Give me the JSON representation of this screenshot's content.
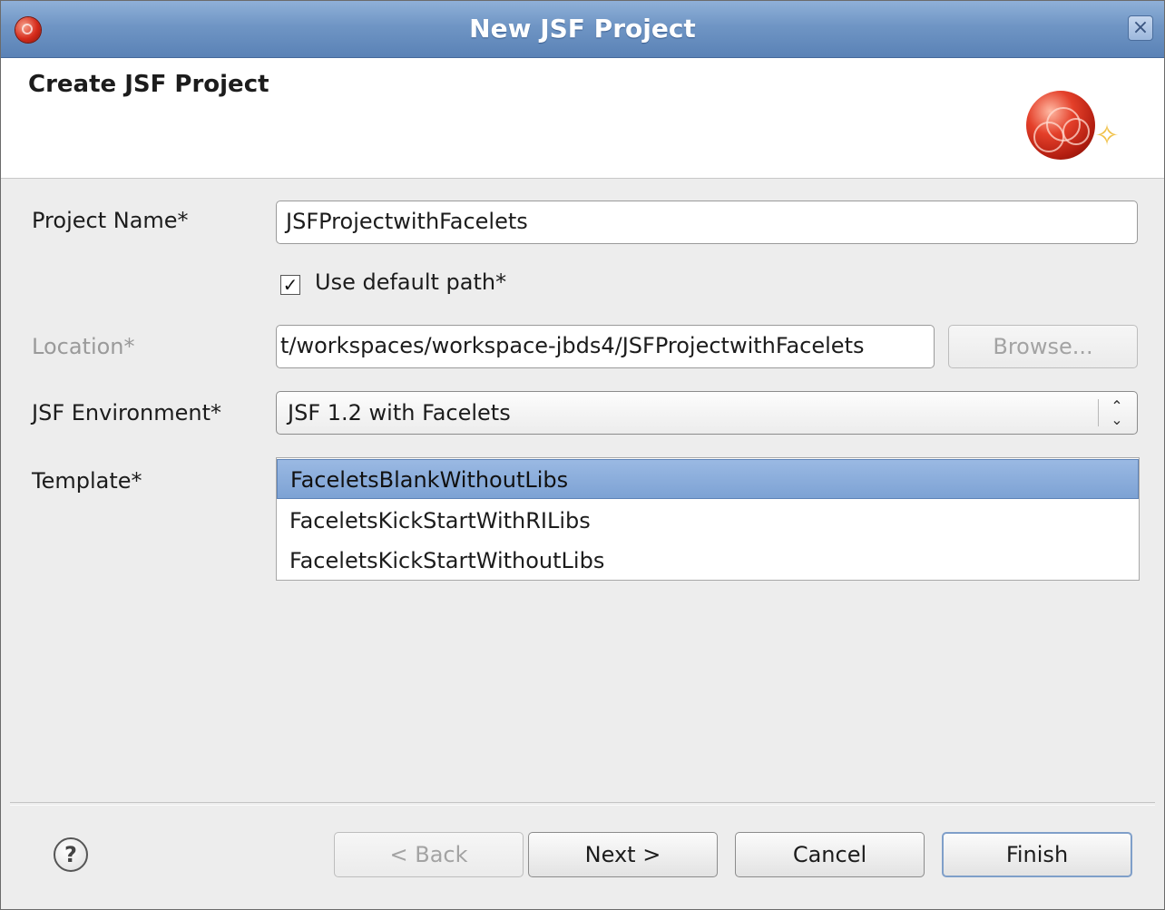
{
  "window": {
    "title": "New JSF Project"
  },
  "banner": {
    "title": "Create JSF Project"
  },
  "form": {
    "project_name": {
      "label": "Project Name*",
      "value": "JSFProjectwithFacelets"
    },
    "use_default_path": {
      "label": "Use default path*",
      "checked": true,
      "mark": "✓"
    },
    "location": {
      "label": "Location*",
      "value": "t/workspaces/workspace-jbds4/JSFProjectwithFacelets",
      "browse_label": "Browse..."
    },
    "environment": {
      "label": "JSF Environment*",
      "value": "JSF 1.2 with Facelets"
    },
    "template": {
      "label": "Template*",
      "items": [
        {
          "label": "FaceletsBlankWithoutLibs",
          "selected": true
        },
        {
          "label": "FaceletsKickStartWithRILibs",
          "selected": false
        },
        {
          "label": "FaceletsKickStartWithoutLibs",
          "selected": false
        }
      ]
    }
  },
  "buttons": {
    "back": "< Back",
    "next": "Next >",
    "cancel": "Cancel",
    "finish": "Finish"
  },
  "icons": {
    "help": "?",
    "close": "×",
    "updown": "⌃⌄"
  },
  "colors": {
    "titlebar": "#6f95c4",
    "selection": "#8aaedb"
  }
}
